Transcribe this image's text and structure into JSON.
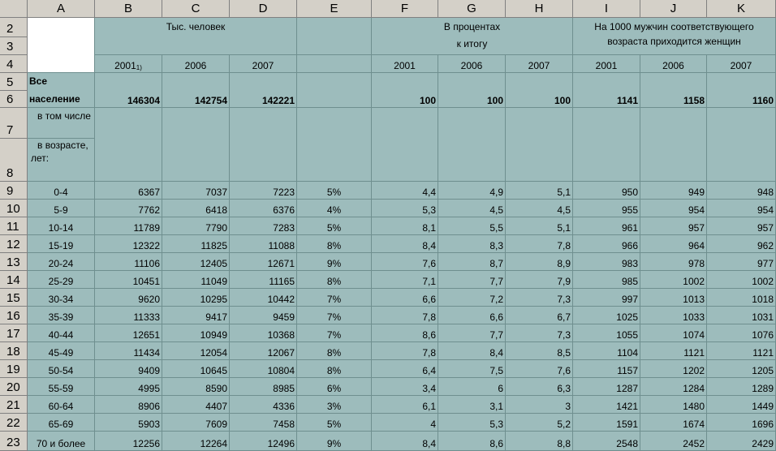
{
  "columns": [
    "A",
    "B",
    "C",
    "D",
    "E",
    "F",
    "G",
    "H",
    "I",
    "J",
    "K"
  ],
  "rows": [
    "2",
    "3",
    "4",
    "5",
    "6",
    "7",
    "8",
    "9",
    "10",
    "11",
    "12",
    "13",
    "14",
    "15",
    "16",
    "17",
    "18",
    "19",
    "20",
    "21",
    "22",
    "23"
  ],
  "header": {
    "thousands": "Тыс. человек",
    "percent_line1": "В процентах",
    "percent_line2": "к итогу",
    "per1000": "На 1000 мужчин соответствующего возраста приходится женщин",
    "y2001": "2001",
    "y2001_sup": "1)",
    "y2006": "2006",
    "y2007": "2007"
  },
  "total": {
    "label_line1": "Все",
    "label_line2": "население",
    "values": [
      "146304",
      "142754",
      "142221",
      "",
      "100",
      "100",
      "100",
      "1141",
      "1158",
      "1160"
    ]
  },
  "sublabels": {
    "incl": "в том числе",
    "age": "в возрасте, лет:"
  },
  "data_rows": [
    {
      "age": "0-4",
      "v": [
        "6367",
        "7037",
        "7223",
        "5%",
        "4,4",
        "4,9",
        "5,1",
        "950",
        "949",
        "948"
      ]
    },
    {
      "age": "5-9",
      "v": [
        "7762",
        "6418",
        "6376",
        "4%",
        "5,3",
        "4,5",
        "4,5",
        "955",
        "954",
        "954"
      ]
    },
    {
      "age": "10-14",
      "v": [
        "11789",
        "7790",
        "7283",
        "5%",
        "8,1",
        "5,5",
        "5,1",
        "961",
        "957",
        "957"
      ]
    },
    {
      "age": "15-19",
      "v": [
        "12322",
        "11825",
        "11088",
        "8%",
        "8,4",
        "8,3",
        "7,8",
        "966",
        "964",
        "962"
      ]
    },
    {
      "age": "20-24",
      "v": [
        "11106",
        "12405",
        "12671",
        "9%",
        "7,6",
        "8,7",
        "8,9",
        "983",
        "978",
        "977"
      ]
    },
    {
      "age": "25-29",
      "v": [
        "10451",
        "11049",
        "11165",
        "8%",
        "7,1",
        "7,7",
        "7,9",
        "985",
        "1002",
        "1002"
      ]
    },
    {
      "age": "30-34",
      "v": [
        "9620",
        "10295",
        "10442",
        "7%",
        "6,6",
        "7,2",
        "7,3",
        "997",
        "1013",
        "1018"
      ]
    },
    {
      "age": "35-39",
      "v": [
        "11333",
        "9417",
        "9459",
        "7%",
        "7,8",
        "6,6",
        "6,7",
        "1025",
        "1033",
        "1031"
      ]
    },
    {
      "age": "40-44",
      "v": [
        "12651",
        "10949",
        "10368",
        "7%",
        "8,6",
        "7,7",
        "7,3",
        "1055",
        "1074",
        "1076"
      ]
    },
    {
      "age": "45-49",
      "v": [
        "11434",
        "12054",
        "12067",
        "8%",
        "7,8",
        "8,4",
        "8,5",
        "1104",
        "1121",
        "1121"
      ]
    },
    {
      "age": "50-54",
      "v": [
        "9409",
        "10645",
        "10804",
        "8%",
        "6,4",
        "7,5",
        "7,6",
        "1157",
        "1202",
        "1205"
      ]
    },
    {
      "age": "55-59",
      "v": [
        "4995",
        "8590",
        "8985",
        "6%",
        "3,4",
        "6",
        "6,3",
        "1287",
        "1284",
        "1289"
      ]
    },
    {
      "age": "60-64",
      "v": [
        "8906",
        "4407",
        "4336",
        "3%",
        "6,1",
        "3,1",
        "3",
        "1421",
        "1480",
        "1449"
      ]
    },
    {
      "age": "65-69",
      "v": [
        "5903",
        "7609",
        "7458",
        "5%",
        "4",
        "5,3",
        "5,2",
        "1591",
        "1674",
        "1696"
      ]
    },
    {
      "age": "70 и более",
      "v": [
        "12256",
        "12264",
        "12496",
        "9%",
        "8,4",
        "8,6",
        "8,8",
        "2548",
        "2452",
        "2429"
      ]
    }
  ]
}
